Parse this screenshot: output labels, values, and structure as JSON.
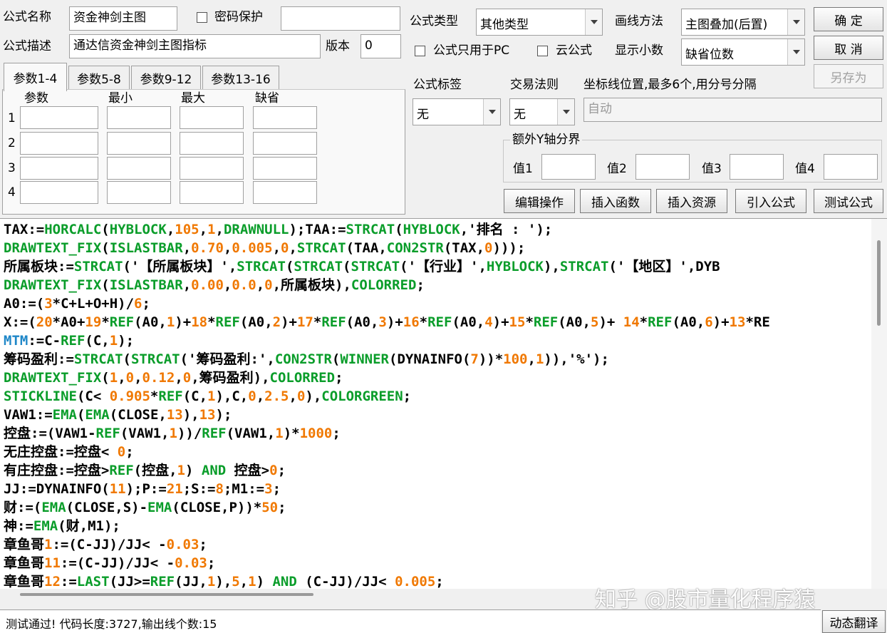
{
  "form": {
    "name_label": "公式名称",
    "name_value": "资金神剑主图",
    "password_label": "密码保护",
    "password_value": "",
    "desc_label": "公式描述",
    "desc_value": "通达信资金神剑主图指标",
    "version_label": "版本",
    "version_value": "0",
    "type_label": "公式类型",
    "type_value": "其他类型",
    "draw_label": "画线方法",
    "draw_value": "主图叠加(后置)",
    "pc_only_label": "公式只用于PC",
    "cloud_label": "云公式",
    "decimal_label": "显示小数",
    "decimal_value": "缺省位数",
    "tag_label": "公式标签",
    "tag_value": "无",
    "trade_label": "交易法则",
    "trade_value": "无",
    "coord_label": "坐标线位置,最多6个,用分号分隔",
    "coord_value": "自动",
    "extra_y_label": "额外Y轴分界",
    "val_labels": [
      "值1",
      "值2",
      "值3",
      "值4"
    ]
  },
  "buttons": {
    "ok": "确 定",
    "cancel": "取 消",
    "save_as": "另存为",
    "edit_ops": "编辑操作",
    "insert_func": "插入函数",
    "insert_res": "插入资源",
    "import_formula": "引入公式",
    "test_formula": "测试公式",
    "dyn_translate": "动态翻译"
  },
  "tabs": [
    "参数1-4",
    "参数5-8",
    "参数9-12",
    "参数13-16"
  ],
  "param_headers": [
    "参数",
    "最小",
    "最大",
    "缺省"
  ],
  "param_rows": [
    "1",
    "2",
    "3",
    "4"
  ],
  "code_lines": [
    "TAX:=HORCALC(HYBLOCK,105,1,DRAWNULL);TAA:=STRCAT(HYBLOCK,'排名 : ');",
    "DRAWTEXT_FIX(ISLASTBAR,0.70,0.005,0,STRCAT(TAA,CON2STR(TAX,0)));",
    "所属板块:=STRCAT('【所属板块】',STRCAT(STRCAT(STRCAT('【行业】',HYBLOCK),STRCAT('【地区】',DYB",
    "DRAWTEXT_FIX(ISLASTBAR,0.00,0.0,0,所属板块),COLORRED;",
    "A0:=(3*C+L+O+H)/6;",
    "X:=(20*A0+19*REF(A0,1)+18*REF(A0,2)+17*REF(A0,3)+16*REF(A0,4)+15*REF(A0,5)+ 14*REF(A0,6)+13*RE",
    "MTM:=C-REF(C,1);",
    "筹码盈利:=STRCAT(STRCAT('筹码盈利:',CON2STR(WINNER(DYNAINFO(7))*100,1)),'%');",
    "DRAWTEXT_FIX(1,0,0.12,0,筹码盈利),COLORRED;",
    "STICKLINE(C< 0.905*REF(C,1),C,0,2.5,0),COLORGREEN;",
    "VAW1:=EMA(EMA(CLOSE,13),13);",
    "控盘:=(VAW1-REF(VAW1,1))/REF(VAW1,1)*1000;",
    "无庄控盘:=控盘< 0;",
    "有庄控盘:=控盘>REF(控盘,1) AND 控盘>0;",
    "JJ:=DYNAINFO(11);P:=21;S:=8;M1:=3;",
    "财:=(EMA(CLOSE,S)-EMA(CLOSE,P))*50;",
    "神:=EMA(财,M1);",
    "章鱼哥1:=(C-JJ)/JJ< -0.03;",
    "章鱼哥11:=(C-JJ)/JJ< -0.03;",
    "章鱼哥12:=LAST(JJ>=REF(JJ,1),5,1) AND (C-JJ)/JJ< 0.005;"
  ],
  "status": "测试通过! 代码长度:3727,输出线个数:15",
  "watermark": "知乎 @股市量化程序猿",
  "colors": {
    "function": "#0a9d2a",
    "number": "#f07800",
    "variable_highlight": "#1f87c8",
    "background": "#f0f0f0"
  }
}
